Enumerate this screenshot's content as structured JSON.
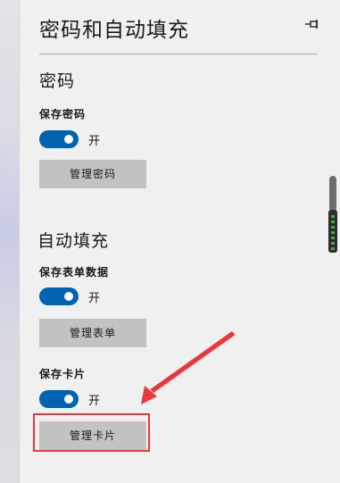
{
  "settings": {
    "title": "密码和自动填充",
    "pin_icon": "pin-icon",
    "passwords": {
      "heading": "密码",
      "save_label": "保存密码",
      "save_state": "开",
      "manage_button": "管理密码"
    },
    "autofill": {
      "heading": "自动填充",
      "forms": {
        "label": "保存表单数据",
        "state": "开",
        "manage_button": "管理表单"
      },
      "cards": {
        "label": "保存卡片",
        "state": "开",
        "manage_button": "管理卡片"
      }
    }
  },
  "colors": {
    "toggle_on": "#0063b1",
    "button_bg": "#c2c2c2",
    "annotation_red": "#e8383d"
  }
}
